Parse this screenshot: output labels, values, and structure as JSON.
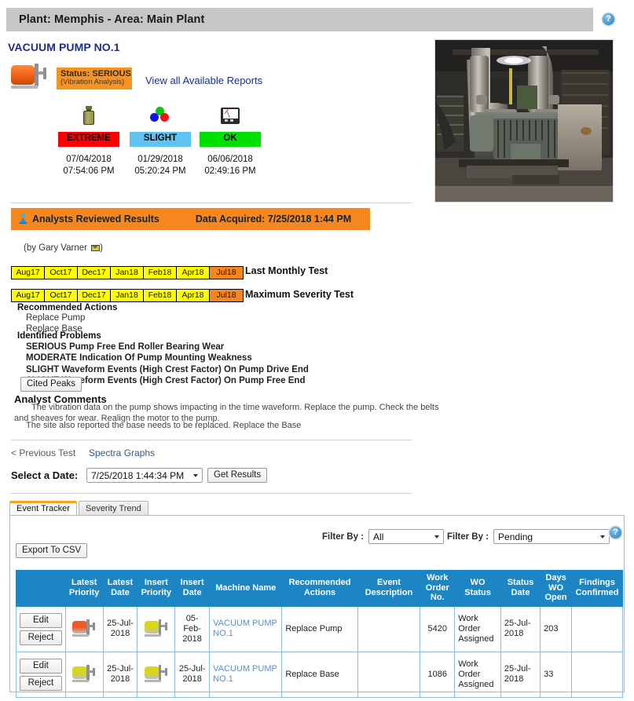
{
  "header": {
    "title": "Plant: Memphis - Area: Main Plant",
    "help_icon": "help-icon",
    "help_label": "?"
  },
  "machine": {
    "name": "VACUUM PUMP NO.1",
    "status_line1": "Status: SERIOUS",
    "status_line2": "(Vibration Analysis)",
    "status_color": "#f79321",
    "reports_link": "View all Available Reports",
    "pump_icon": "pump-icon",
    "photo_alt": "vacuum pump machine photo"
  },
  "severity": [
    {
      "icon": "oil-bottle-icon",
      "label": "EXTREME",
      "color": "#ff0000",
      "date": "07/04/2018",
      "time": "07:54:06 PM"
    },
    {
      "icon": "rgb-circles-icon",
      "label": "SLIGHT",
      "color": "#5fc3f0",
      "date": "01/29/2018",
      "time": "05:20:24 PM"
    },
    {
      "icon": "meter-icon",
      "label": "OK",
      "color": "#00e000",
      "date": "06/06/2018",
      "time": "02:49:16 PM"
    }
  ],
  "reviewed": {
    "title": "Analysts Reviewed Results",
    "acquired": "Data Acquired: 7/25/2018 1:44 PM",
    "bar_color": "#f6861f",
    "analyst_by": "(by Gary Varner ",
    "analyst_by_end": ")",
    "icon": "analyst-icon",
    "mail_icon": "mail-icon"
  },
  "trend_strips": [
    {
      "name": "last-monthly-test",
      "label": "Last Monthly Test",
      "months": [
        {
          "text": "Aug17",
          "current": false
        },
        {
          "text": "Oct17",
          "current": false
        },
        {
          "text": "Dec17",
          "current": false
        },
        {
          "text": "Jan18",
          "current": false
        },
        {
          "text": "Feb18",
          "current": false
        },
        {
          "text": "Apr18",
          "current": false
        },
        {
          "text": "Jul18",
          "current": true
        }
      ]
    },
    {
      "name": "maximum-severity-test",
      "label": "Maximum Severity Test",
      "months": [
        {
          "text": "Aug17",
          "current": false
        },
        {
          "text": "Oct17",
          "current": false
        },
        {
          "text": "Dec17",
          "current": false
        },
        {
          "text": "Jan18",
          "current": false
        },
        {
          "text": "Feb18",
          "current": false
        },
        {
          "text": "Apr18",
          "current": false
        },
        {
          "text": "Jul18",
          "current": true
        }
      ]
    }
  ],
  "recommended": {
    "heading": "Recommended Actions",
    "items": [
      "Replace Pump",
      "Replace Base"
    ]
  },
  "problems": {
    "heading": "Identified Problems",
    "items": [
      "SERIOUS Pump Free End Roller Bearing Wear",
      "MODERATE Indication Of Pump Mounting Weakness",
      "SLIGHT Waveform Events (High Crest Factor) On Pump Drive End",
      "SLIGHT Waveform Events (High Crest Factor) On Pump Free End"
    ]
  },
  "cited_peaks_label": "Cited Peaks",
  "comments": {
    "heading": "Analyst Comments",
    "paragraph1": "The vibration data on the pump shows impacting in the time waveform. Replace the pump. Check the belts and sheaves for wear. Realign the motor to the pump.",
    "paragraph2": "The site also reported the base needs to be replaced. Replace the Base"
  },
  "nav": {
    "previous_test": "< Previous Test",
    "spectra_graphs": "Spectra Graphs"
  },
  "date_picker": {
    "label": "Select a Date:",
    "value": "7/25/2018 1:44:34 PM",
    "get_results_label": "Get Results"
  },
  "tabs": [
    {
      "label": "Event Tracker",
      "active": true
    },
    {
      "label": "Severity Trend",
      "active": false
    }
  ],
  "tracker": {
    "export_label": "Export To CSV",
    "filter1_label": "Filter By :",
    "filter1_value": "All",
    "filter2_label": "Filter By :",
    "filter2_value": "Pending",
    "help_label": "?"
  },
  "table": {
    "columns": [
      "",
      "Latest Priority",
      "Latest Date",
      "Insert Priority",
      "Insert Date",
      "Machine Name",
      "Recommended Actions",
      "Event Description",
      "Work Order No.",
      "WO Status",
      "Status Date",
      "Days WO Open",
      "Findings Confirmed"
    ],
    "edit_label": "Edit",
    "reject_label": "Reject",
    "rows": [
      {
        "latest_priority_color": "#f05a1e",
        "latest_date": "25-Jul-2018",
        "insert_priority_color": "#d8d81a",
        "insert_date": "05-Feb-2018",
        "machine_name": "VACUUM PUMP NO.1",
        "recommended_action": "Replace Pump",
        "event_description": "",
        "work_order_no": "5420",
        "wo_status": "Work Order Assigned",
        "status_date": "25-Jul-2018",
        "days_wo_open": "203",
        "findings_confirmed": ""
      },
      {
        "latest_priority_color": "#d8d81a",
        "latest_date": "25-Jul-2018",
        "insert_priority_color": "#d8d81a",
        "insert_date": "25-Jul-2018",
        "machine_name": "VACUUM PUMP NO.1",
        "recommended_action": "Replace Base",
        "event_description": "",
        "work_order_no": "1086",
        "wo_status": "Work Order Assigned",
        "status_date": "25-Jul-2018",
        "days_wo_open": "33",
        "findings_confirmed": ""
      }
    ]
  }
}
